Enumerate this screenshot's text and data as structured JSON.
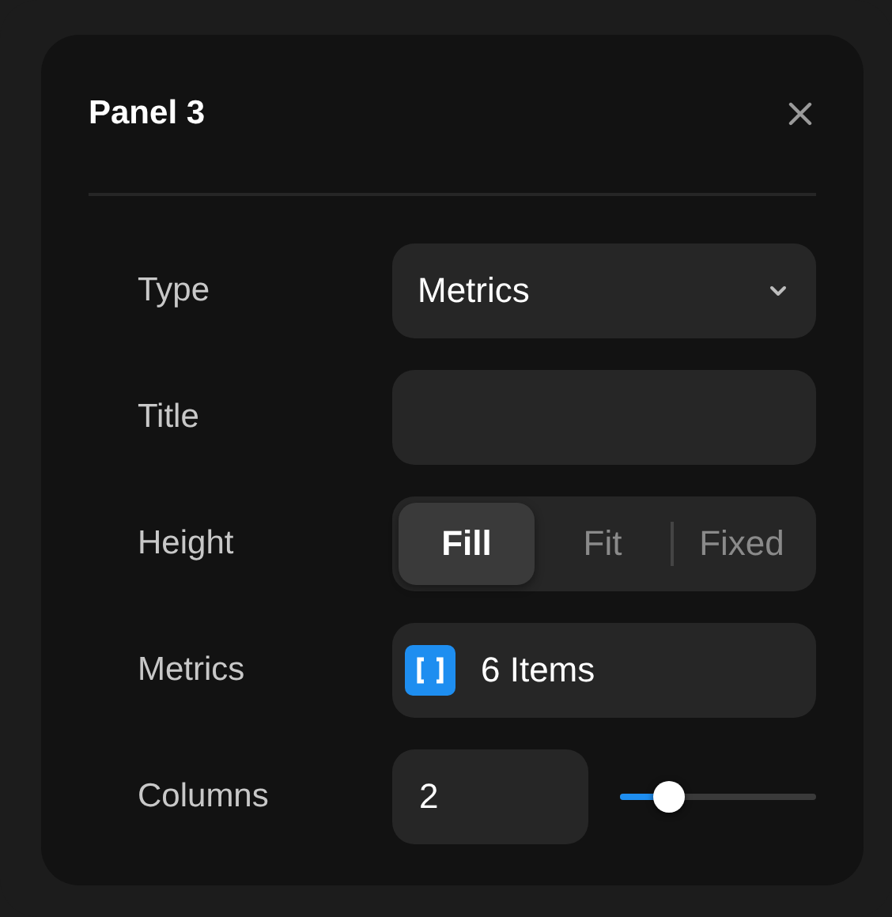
{
  "panel": {
    "title": "Panel 3"
  },
  "rows": [
    {
      "kind": "select",
      "label": "Type",
      "value": "Metrics"
    },
    {
      "kind": "text",
      "label": "Title"
    },
    {
      "kind": "segmented",
      "label": "Height",
      "options": [
        {
          "label": "Fill",
          "selected": true
        },
        {
          "label": "Fit",
          "selected": false
        },
        {
          "label": "Fixed",
          "selected": false
        }
      ]
    },
    {
      "kind": "metrics",
      "label": "Metrics",
      "value": "6 Items"
    },
    {
      "kind": "number_slider",
      "label": "Columns",
      "value": "2",
      "level": 0.25
    }
  ]
}
